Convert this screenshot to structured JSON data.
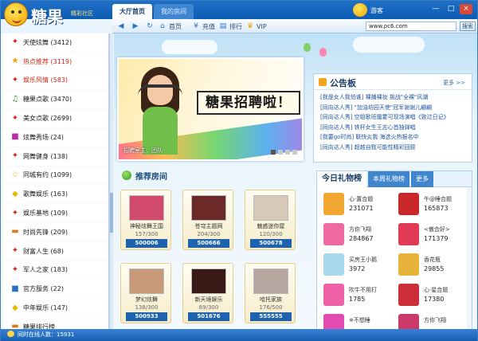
{
  "app": {
    "brand": "糖果",
    "slogan": "精彩社区",
    "tabs": [
      "大厅首页",
      "我的房间"
    ],
    "user": "游客",
    "window_controls": [
      "—",
      "□",
      "×"
    ]
  },
  "toolbar": {
    "home": "首页",
    "recharge": "充值",
    "ranking": "排行",
    "vip": "VIP",
    "address": "www.pc6.com",
    "search": "搜索"
  },
  "sidebar": {
    "items": [
      {
        "label": "天使炫舞 (3412)",
        "icon": "✦",
        "color": "#d4261d",
        "hot": false
      },
      {
        "label": "热点推荐 (3119)",
        "icon": "★",
        "color": "#f2a200",
        "hot": true
      },
      {
        "label": "娱乐风情 (583)",
        "icon": "✦",
        "color": "#d4261d",
        "hot": true
      },
      {
        "label": "糖果点歌 (3470)",
        "icon": "♫",
        "color": "#3a9a2a",
        "hot": false
      },
      {
        "label": "美女点歌 (2699)",
        "icon": "✦",
        "color": "#d4261d",
        "hot": false
      },
      {
        "label": "炫舞秀场 (24)",
        "icon": "■",
        "color": "#c02aa6",
        "hot": false
      },
      {
        "label": "网舞健身 (138)",
        "icon": "✦",
        "color": "#d4261d",
        "hot": false
      },
      {
        "label": "同城有约 (1099)",
        "icon": "☆",
        "color": "#f2a200",
        "hot": false
      },
      {
        "label": "歌舞娱乐 (163)",
        "icon": "◆",
        "color": "#e8b800",
        "hot": false
      },
      {
        "label": "娱乐基地 (109)",
        "icon": "✦",
        "color": "#d4261d",
        "hot": false
      },
      {
        "label": "时尚先锋 (209)",
        "icon": "▬",
        "color": "#e07a20",
        "hot": false
      },
      {
        "label": "财富人生 (68)",
        "icon": "✦",
        "color": "#d4261d",
        "hot": false
      },
      {
        "label": "军人之家 (183)",
        "icon": "✦",
        "color": "#d4261d",
        "hot": false
      },
      {
        "label": "官方服务 (22)",
        "icon": "■",
        "color": "#2a72c4",
        "hot": false
      },
      {
        "label": "中年娱乐 (147)",
        "icon": "◆",
        "color": "#e8b800",
        "hot": false
      },
      {
        "label": "糖果排行榜",
        "icon": "▬",
        "color": "#e07a20",
        "hot": false
      }
    ]
  },
  "status": {
    "online_label": "同时在线人数：",
    "online_count": "15931"
  },
  "banner": {
    "title": "糖果招聘啦！",
    "caption": "招聘室主、团队"
  },
  "rooms": {
    "header": "推荐房间",
    "items": [
      {
        "name": "神秘炫舞王国",
        "count": "157/300",
        "id": "500006",
        "thumb": "#d24a6c"
      },
      {
        "name": "苍穹主题网",
        "count": "204/300",
        "id": "500666",
        "thumb": "#6b2a28"
      },
      {
        "name": "魅惑迷你屋",
        "count": "120/300",
        "id": "500678",
        "thumb": "#d8c8b8"
      },
      {
        "name": "梦幻炫舞",
        "count": "138/300",
        "id": "500933",
        "thumb": "#c89a7a"
      },
      {
        "name": "新天境娱乐",
        "count": "89/300",
        "id": "501676",
        "thumb": "#3a1a16"
      },
      {
        "name": "哈托家族",
        "count": "176/500",
        "id": "555555",
        "thumb": "#b7a6a0"
      }
    ]
  },
  "notice": {
    "title": "公告板",
    "more": "更多 >>",
    "items": [
      "[我是女人我怕谁] 裸播裸妆 挑战\"全裸\"风潮",
      "[同向达人秀] \"加油坊园天使\"冠军谢谢儿翩翩",
      "[同向达人秀] 空姐歌班魔霍可现场演唱《致过日记》",
      "[同向达人秀] 铁杆女生王志心首独弹唱",
      "[我要go时尚] 联快炎我 海选火热报名中",
      "[同向达人秀] 超越自我可能性精彩回顾"
    ]
  },
  "gifts": {
    "tabs": [
      "今日礼物榜",
      "本周礼物榜",
      "更多"
    ],
    "items": [
      {
        "name": "心·置合题",
        "num": "231071",
        "color": "#f0a830"
      },
      {
        "name": "午@睡合题",
        "num": "165873",
        "color": "#c8282a"
      },
      {
        "name": "方你飞翔",
        "num": "284867",
        "color": "#ef6aa0"
      },
      {
        "name": "<傲合好>",
        "num": "171379",
        "color": "#e03a56"
      },
      {
        "name": "买房王小鹅",
        "num": "3972",
        "color": "#a8d8ee"
      },
      {
        "name": "香花瓶",
        "num": "29855",
        "color": "#e7b338"
      },
      {
        "name": "吹牛不用打",
        "num": "1785",
        "color": "#ef62a8"
      },
      {
        "name": "心·星合题",
        "num": "17380",
        "color": "#cc2f3a"
      },
      {
        "name": "※不想睡",
        "num": "",
        "color": "#e24bb0"
      },
      {
        "name": "方你飞翔",
        "num": "",
        "color": "#cb3a68"
      }
    ]
  }
}
